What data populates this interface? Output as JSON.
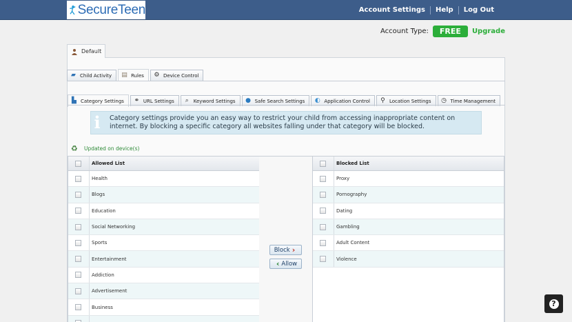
{
  "brand": {
    "name": "SecureTeen",
    "logo_icon": "running-figure-icon"
  },
  "topnav": {
    "account_settings": "Account Settings",
    "help": "Help",
    "logout": "Log Out"
  },
  "account": {
    "label": "Account Type:",
    "plan": "FREE",
    "upgrade": "Upgrade",
    "plan_color": "#2cae3a"
  },
  "profile_tab": {
    "label": "Default",
    "icon": "profile-icon"
  },
  "main_tabs": [
    {
      "label": "Child Activity",
      "icon": "gift-icon"
    },
    {
      "label": "Rules",
      "icon": "rules-icon"
    },
    {
      "label": "Device Control",
      "icon": "device-icon"
    }
  ],
  "sub_tabs": [
    {
      "label": "Category Settings",
      "icon": "category-icon"
    },
    {
      "label": "URL Settings",
      "icon": "url-icon"
    },
    {
      "label": "Keyword Settings",
      "icon": "magnifier-icon"
    },
    {
      "label": "Safe Search Settings",
      "icon": "globe-icon"
    },
    {
      "label": "Application Control",
      "icon": "app-icon"
    },
    {
      "label": "Location Settings",
      "icon": "location-icon"
    },
    {
      "label": "Time Management",
      "icon": "clock-icon"
    }
  ],
  "info": {
    "text": "Category settings provide you an easy way to restrict your child from accessing inappropriate content on internet. By blocking a specific category all websites falling under that category will be blocked."
  },
  "status": {
    "text": "Updated on device(s)"
  },
  "allowed": {
    "header": "Allowed List",
    "items": [
      "Health",
      "Blogs",
      "Education",
      "Social Networking",
      "Sports",
      "Entertainment",
      "Addiction",
      "Advertisement",
      "Business",
      ""
    ]
  },
  "blocked": {
    "header": "Blocked List",
    "items": [
      "Proxy",
      "Pornography",
      "Dating",
      "Gambling",
      "Adult Content",
      "Violence"
    ]
  },
  "actions": {
    "block": "Block",
    "allow": "Allow"
  }
}
